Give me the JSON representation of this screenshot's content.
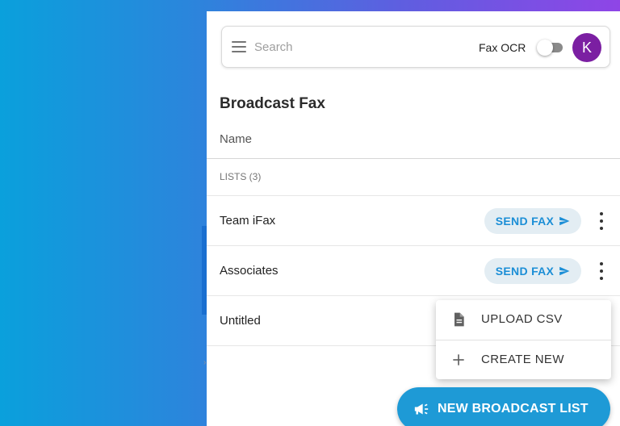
{
  "search": {
    "placeholder": "Search"
  },
  "header": {
    "fax_ocr_label": "Fax OCR",
    "fax_ocr_enabled": false,
    "avatar_initial": "K"
  },
  "page": {
    "title": "Broadcast Fax",
    "column_header": "Name",
    "lists_count_label": "LISTS (3)"
  },
  "lists": [
    {
      "name": "Team iFax",
      "action_label": "SEND FAX"
    },
    {
      "name": "Associates",
      "action_label": "SEND FAX"
    },
    {
      "name": "Untitled"
    }
  ],
  "context_menu": {
    "items": [
      {
        "label": "UPLOAD CSV",
        "icon": "file-icon"
      },
      {
        "label": "CREATE NEW",
        "icon": "plus-icon"
      }
    ]
  },
  "fab": {
    "label": "NEW BROADCAST LIST",
    "icon": "megaphone-icon"
  },
  "colors": {
    "accent": "#1e9ad6",
    "avatar": "#7b1fa2",
    "send_button_bg": "#e3edf3"
  }
}
